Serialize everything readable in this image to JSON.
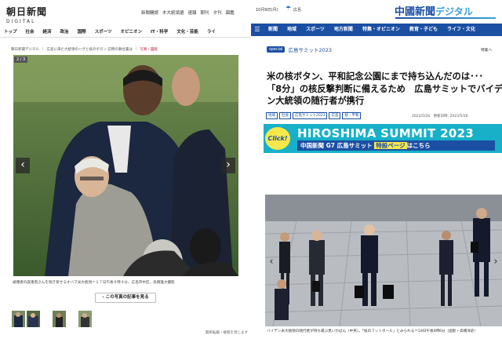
{
  "left": {
    "brand": {
      "logo_ja": "朝日新聞",
      "logo_en": "DIGITAL"
    },
    "top_links": [
      "新聞購読",
      "木大統領選",
      "速報",
      "朝刊",
      "夕刊",
      "図鑑"
    ],
    "nav": [
      "トップ",
      "社会",
      "経済",
      "政治",
      "国際",
      "スポーツ",
      "オピニオン",
      "IT・科学",
      "文化・芸能",
      "ライ"
    ],
    "breadcrumb": [
      "朝日新聞デジタル",
      "広島に来た大統領のハグと核のボタン 訪問の舞台裏は",
      "写真・図版"
    ],
    "photo_counter": "2 / 3",
    "caption": "被爆者の森重昭さんを抱き寄せるオバマ米大統領＝２７日午後６時９分、広島市中区、高橋雄大撮影",
    "article_button": "この写真の記事を見る",
    "copyright": "無断転載・複製を禁じます",
    "colors": {
      "accent": "#c8102e"
    }
  },
  "right": {
    "top": {
      "date": "10月9日(月)",
      "region": "広島",
      "weather_icon": "umbrella-icon",
      "logo_main": "中國新聞",
      "logo_sub": "デジタル"
    },
    "nav": [
      "新聞",
      "地域",
      "スポーツ",
      "地方新聞",
      "特集・オピニオン",
      "教育・子ども",
      "ライフ・文化"
    ],
    "special_label": "special",
    "special_title": "広島サミット2023",
    "more_label": "特集へ",
    "headline": [
      "米の核ボタン、平和記念公園にまで持ち込んだのは･･･",
      "「8分」の核反撃判断に備えるため　広島サミットでバイデ",
      "ン大統領の随行者が携行"
    ],
    "tags": [
      "地域",
      "社会",
      "広島サミット2023",
      "広島",
      "核・平和"
    ],
    "dates": "2023/5/26　更新日時: 2023/5/26",
    "banner": {
      "click_label": "Click!",
      "title": "HIROSHIMA SUMMIT 2023",
      "subtitle_prefix": "中国新聞 G7 広島サミット",
      "subtitle_highlight": "特設ページ",
      "subtitle_suffix": "はこちら"
    },
    "photo_caption": "バイデン米大統領の随行者が持ち運ぶ黒いかばん（中央）。「核のフットボール」とみられる＝19日午後0時6分（画影・高橋洋史）",
    "colors": {
      "brand": "#1b4fa3",
      "banner": "#18b0c8",
      "highlight": "#f7e84a"
    }
  }
}
